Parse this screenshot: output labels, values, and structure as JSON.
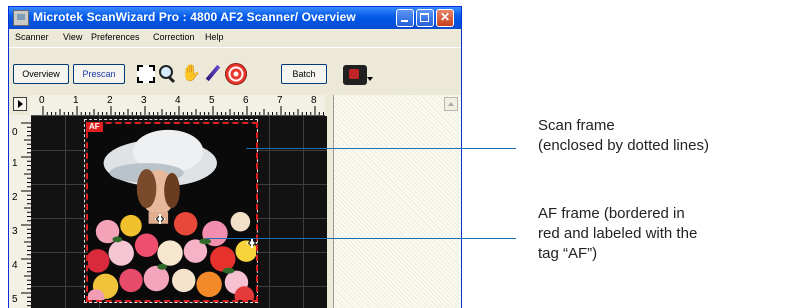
{
  "window": {
    "title": "Microtek ScanWizard Pro : 4800 AF2 Scanner/ Overview",
    "title_color": "#0054e3"
  },
  "menu": {
    "items": [
      "Scanner",
      "View",
      "Preferences",
      "Correction",
      "Help"
    ]
  },
  "toolbar": {
    "overview_label": "Overview",
    "prescan_label": "Prescan",
    "batch_label": "Batch",
    "tools": [
      "select-frame-icon",
      "zoom-icon",
      "hand-icon",
      "pen-icon",
      "target-icon",
      "camera-icon"
    ]
  },
  "rulers": {
    "horizontal": [
      "0",
      "1",
      "2",
      "3",
      "4",
      "5",
      "6",
      "7",
      "8"
    ],
    "vertical": [
      "0",
      "1",
      "2",
      "3",
      "4",
      "5"
    ]
  },
  "preview": {
    "af_tag": "AF",
    "af_color": "#e02020"
  },
  "callouts": {
    "scan_frame": [
      "Scan frame",
      "(enclosed by dotted lines)"
    ],
    "af_frame": [
      "AF frame (bordered in",
      "red and labeled with the",
      "tag “AF”)"
    ],
    "line_color": "#1a6fb5"
  }
}
